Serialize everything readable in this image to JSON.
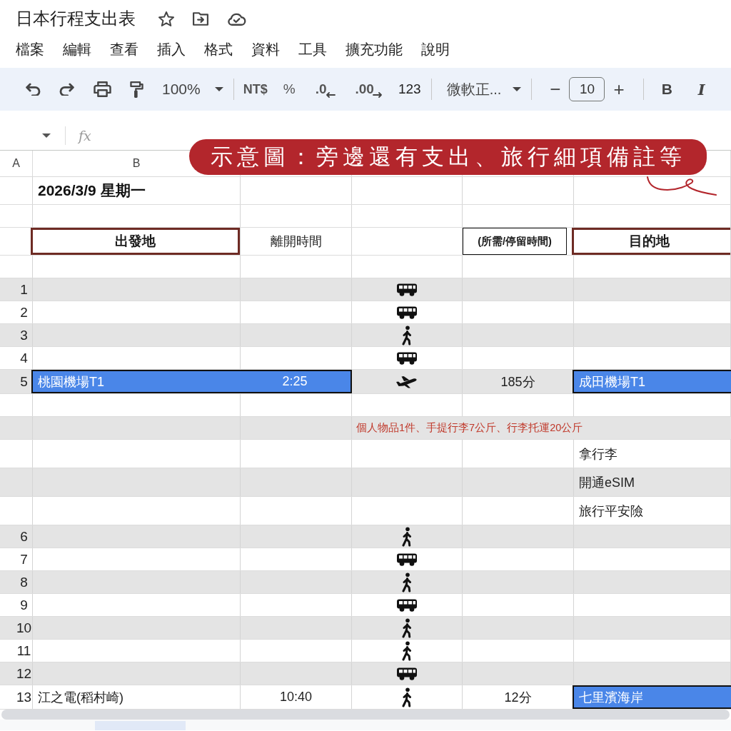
{
  "title_bar": {
    "title": "日本行程支出表"
  },
  "menu": [
    "檔案",
    "編輯",
    "查看",
    "插入",
    "格式",
    "資料",
    "工具",
    "擴充功能",
    "說明"
  ],
  "toolbar": {
    "zoom": "100%",
    "currency": "NT$",
    "percent": "%",
    "decrease_decimal": ".0",
    "increase_decimal": ".00",
    "number_format": "123",
    "font": "微軟正...",
    "font_size_minus": "−",
    "font_size": "10",
    "font_size_plus": "+",
    "bold": "B",
    "italic": "I"
  },
  "formula_bar": {
    "fx": "fx"
  },
  "annotation": {
    "text": "示意圖：旁邊還有支出、旅行細項備註等"
  },
  "column_headers": [
    "A",
    "B"
  ],
  "rows": [
    {
      "kind": "title",
      "shaded": false,
      "text": "2026/3/9 星期一"
    },
    {
      "kind": "blank",
      "shaded": false
    },
    {
      "kind": "header",
      "shaded": false,
      "origin": "出發地",
      "depart": "離開時間",
      "duration": "(所需/停留時間)",
      "destination": "目的地"
    },
    {
      "kind": "blank",
      "shaded": false
    },
    {
      "kind": "trip",
      "shaded": true,
      "number": "1",
      "transport": {
        "kind": "bus"
      },
      "route_highlight": false,
      "destination_highlight": false
    },
    {
      "kind": "trip",
      "shaded": false,
      "number": "2",
      "transport": {
        "kind": "bus"
      },
      "route_highlight": false,
      "destination_highlight": false
    },
    {
      "kind": "trip",
      "shaded": true,
      "number": "3",
      "transport": {
        "kind": "walk"
      },
      "route_highlight": false,
      "destination_highlight": false
    },
    {
      "kind": "trip",
      "shaded": false,
      "number": "4",
      "transport": {
        "kind": "bus"
      },
      "route_highlight": false,
      "destination_highlight": false
    },
    {
      "kind": "trip",
      "shaded": true,
      "number": "5",
      "transport": {
        "kind": "plane"
      },
      "origin": "桃園機場T1",
      "depart": "2:25",
      "duration": "185分",
      "destination": "成田機場T1",
      "route_highlight": true,
      "destination_highlight": true
    },
    {
      "kind": "blank",
      "shaded": false
    },
    {
      "kind": "note",
      "shaded": true,
      "text": "個人物品1件、手提行李7公斤、行李托運20公斤"
    },
    {
      "kind": "detail",
      "shaded": false,
      "text": "拿行李"
    },
    {
      "kind": "detail",
      "shaded": true,
      "text": "開通eSIM"
    },
    {
      "kind": "detail",
      "shaded": false,
      "text": "旅行平安險"
    },
    {
      "kind": "trip",
      "shaded": true,
      "number": "6",
      "transport": {
        "kind": "walk"
      },
      "route_highlight": false,
      "destination_highlight": false
    },
    {
      "kind": "trip",
      "shaded": false,
      "number": "7",
      "transport": {
        "kind": "bus"
      },
      "route_highlight": false,
      "destination_highlight": false
    },
    {
      "kind": "trip",
      "shaded": true,
      "number": "8",
      "transport": {
        "kind": "walk"
      },
      "route_highlight": false,
      "destination_highlight": false
    },
    {
      "kind": "trip",
      "shaded": false,
      "number": "9",
      "transport": {
        "kind": "bus"
      },
      "route_highlight": false,
      "destination_highlight": false
    },
    {
      "kind": "trip",
      "shaded": true,
      "number": "10",
      "transport": {
        "kind": "walk"
      },
      "route_highlight": false,
      "destination_highlight": false
    },
    {
      "kind": "trip",
      "shaded": false,
      "number": "11",
      "transport": {
        "kind": "walk"
      },
      "route_highlight": false,
      "destination_highlight": false
    },
    {
      "kind": "trip",
      "shaded": true,
      "number": "12",
      "transport": {
        "kind": "bus"
      },
      "route_highlight": false,
      "destination_highlight": false
    },
    {
      "kind": "trip",
      "shaded": false,
      "number": "13",
      "transport": {
        "kind": "walk"
      },
      "origin": "江之電(稻村崎)",
      "depart": "10:40",
      "duration": "12分",
      "destination": "七里濱海岸",
      "route_highlight": false,
      "destination_highlight": true
    }
  ]
}
